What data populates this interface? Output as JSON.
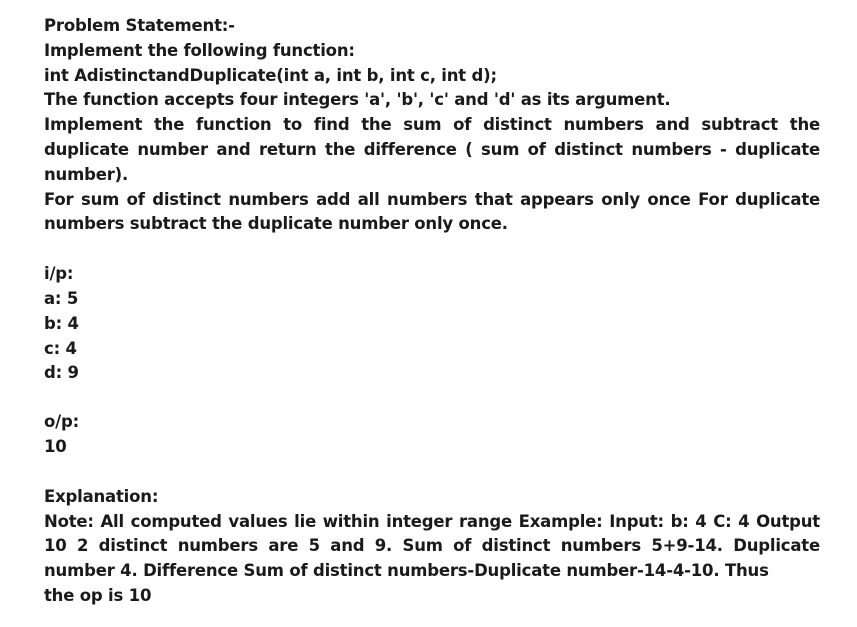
{
  "problem": {
    "heading": "Problem Statement:-",
    "line1": "Implement the following function:",
    "signature": "int AdistinctandDuplicate(int a, int b, int c, int d);",
    "accepts": "The function accepts four integers 'a', 'b', 'c' and 'd' as its argument.",
    "task": "Implement the function to find the sum of distinct numbers and subtract the duplicate number and return the difference ( sum of distinct numbers - duplicate number).",
    "rule": "For sum of distinct numbers add all numbers that appears only once For duplicate numbers subtract the duplicate number only once."
  },
  "input": {
    "label": "i/p:",
    "a": "a: 5",
    "b": "b: 4",
    "c": "c: 4",
    "d": "d: 9"
  },
  "output": {
    "label": "o/p:",
    "value": "10"
  },
  "explanation": {
    "label": "Explanation:",
    "body": "Note: All computed values lie within integer range Example: Input: b: 4 C: 4 Output 10 2 distinct numbers are 5 and 9. Sum of distinct numbers 5+9-14. Duplicate number 4. Difference Sum of distinct numbers-Duplicate number-14-4-10. Thus",
    "last": "the op is 10"
  }
}
